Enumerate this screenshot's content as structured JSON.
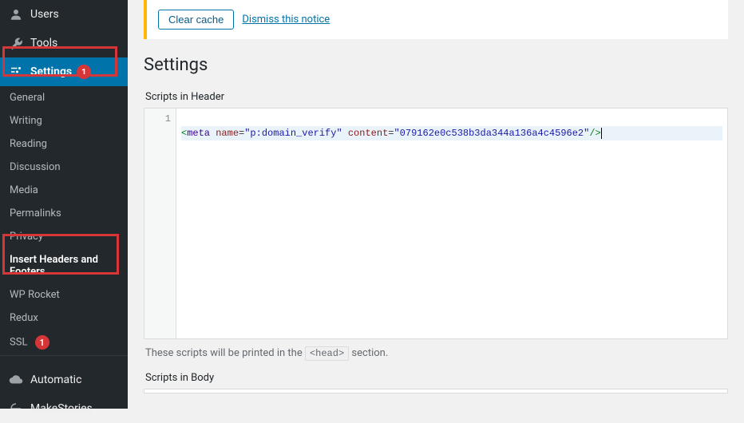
{
  "sidebar": {
    "top": [
      {
        "label": "Users",
        "icon": "user"
      },
      {
        "label": "Tools",
        "icon": "wrench"
      },
      {
        "label": "Settings",
        "icon": "sliders",
        "active": true,
        "badge": "1"
      }
    ],
    "sub": [
      {
        "label": "General"
      },
      {
        "label": "Writing"
      },
      {
        "label": "Reading"
      },
      {
        "label": "Discussion"
      },
      {
        "label": "Media"
      },
      {
        "label": "Permalinks"
      },
      {
        "label": "Privacy"
      },
      {
        "label": "Insert Headers and Footers",
        "current": true
      },
      {
        "label": "WP Rocket"
      },
      {
        "label": "Redux"
      },
      {
        "label": "SSL",
        "badge": "1"
      }
    ],
    "bottom": [
      {
        "label": "Automatic",
        "icon": "cloud"
      },
      {
        "label": "MakeStories",
        "icon": "makestories"
      }
    ]
  },
  "notice": {
    "clear_cache": "Clear cache",
    "dismiss": "Dismiss this notice"
  },
  "page": {
    "title": "Settings",
    "header_label": "Scripts in Header",
    "body_label": "Scripts in Body",
    "description_prefix": "These scripts will be printed in the ",
    "description_code": "<head>",
    "description_suffix": " section.",
    "editor": {
      "line_number": "1",
      "code": {
        "open": "<",
        "tag": "meta",
        "attr1_name": "name",
        "attr1_val": "\"p:domain_verify\"",
        "attr2_name": "content",
        "attr2_val": "\"079162e0c538b3da344a136a4c4596e2\"",
        "close": "/>"
      }
    }
  }
}
